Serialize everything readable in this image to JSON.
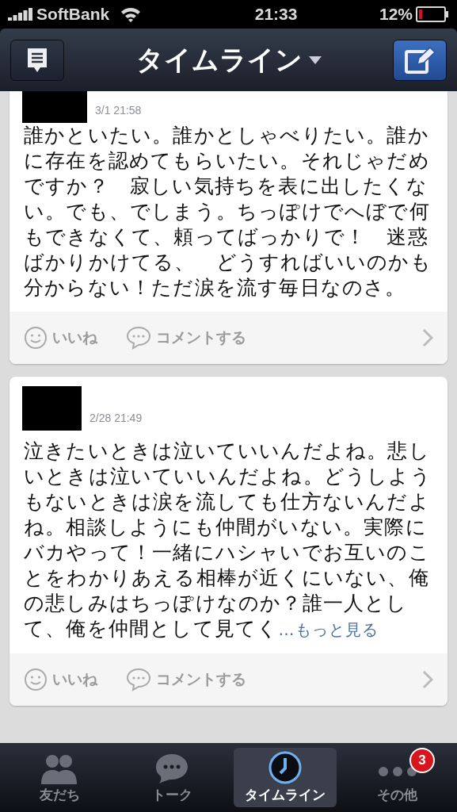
{
  "status_bar": {
    "carrier": "SoftBank",
    "time": "21:33",
    "battery": "12%"
  },
  "nav_bar": {
    "title": "タイムライン"
  },
  "posts": [
    {
      "date": "3/1 21:58",
      "text": "誰かといたい。誰かとしゃべりたい。誰かに存在を認めてもらいたい。それじゃだめですか？　寂しい気持ちを表に出したくない。でも、でしまう。ちっぽけでへぼで何もできなくて、頼ってばっかりで！　迷惑ばかりかけてる、　どうすればいいのかも分からない！ただ涙を流す毎日なのさ。",
      "like": "いいね",
      "comment": "コメントする"
    },
    {
      "date": "2/28 21:49",
      "text": "泣きたいときは泣いていいんだよね。悲しいときは泣いていいんだよね。どうしようもないときは涙を流しても仕方ないんだよね。相談しようにも仲間がいない。実際にバカやって！一緒にハシャいでお互いのことをわかりあえる相棒が近くにいない、俺の悲しみはちっぽけなのか？誰一人として、俺を仲間として見てく",
      "more": "…もっと見る",
      "like": "いいね",
      "comment": "コメントする"
    }
  ],
  "tab_bar": [
    {
      "label": "友だち",
      "kind": "friends",
      "selected": false
    },
    {
      "label": "トーク",
      "kind": "talk",
      "selected": false
    },
    {
      "label": "タイムライン",
      "kind": "timeline",
      "selected": true
    },
    {
      "label": "その他",
      "kind": "more",
      "selected": false,
      "badge": "3"
    }
  ]
}
